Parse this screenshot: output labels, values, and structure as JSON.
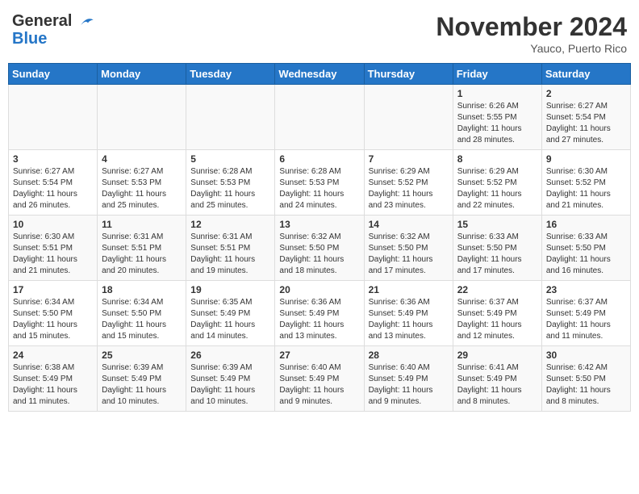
{
  "header": {
    "logo_line1": "General",
    "logo_line2": "Blue",
    "month": "November 2024",
    "location": "Yauco, Puerto Rico"
  },
  "days_of_week": [
    "Sunday",
    "Monday",
    "Tuesday",
    "Wednesday",
    "Thursday",
    "Friday",
    "Saturday"
  ],
  "weeks": [
    [
      {
        "day": "",
        "info": ""
      },
      {
        "day": "",
        "info": ""
      },
      {
        "day": "",
        "info": ""
      },
      {
        "day": "",
        "info": ""
      },
      {
        "day": "",
        "info": ""
      },
      {
        "day": "1",
        "info": "Sunrise: 6:26 AM\nSunset: 5:55 PM\nDaylight: 11 hours and 28 minutes."
      },
      {
        "day": "2",
        "info": "Sunrise: 6:27 AM\nSunset: 5:54 PM\nDaylight: 11 hours and 27 minutes."
      }
    ],
    [
      {
        "day": "3",
        "info": "Sunrise: 6:27 AM\nSunset: 5:54 PM\nDaylight: 11 hours and 26 minutes."
      },
      {
        "day": "4",
        "info": "Sunrise: 6:27 AM\nSunset: 5:53 PM\nDaylight: 11 hours and 25 minutes."
      },
      {
        "day": "5",
        "info": "Sunrise: 6:28 AM\nSunset: 5:53 PM\nDaylight: 11 hours and 25 minutes."
      },
      {
        "day": "6",
        "info": "Sunrise: 6:28 AM\nSunset: 5:53 PM\nDaylight: 11 hours and 24 minutes."
      },
      {
        "day": "7",
        "info": "Sunrise: 6:29 AM\nSunset: 5:52 PM\nDaylight: 11 hours and 23 minutes."
      },
      {
        "day": "8",
        "info": "Sunrise: 6:29 AM\nSunset: 5:52 PM\nDaylight: 11 hours and 22 minutes."
      },
      {
        "day": "9",
        "info": "Sunrise: 6:30 AM\nSunset: 5:52 PM\nDaylight: 11 hours and 21 minutes."
      }
    ],
    [
      {
        "day": "10",
        "info": "Sunrise: 6:30 AM\nSunset: 5:51 PM\nDaylight: 11 hours and 21 minutes."
      },
      {
        "day": "11",
        "info": "Sunrise: 6:31 AM\nSunset: 5:51 PM\nDaylight: 11 hours and 20 minutes."
      },
      {
        "day": "12",
        "info": "Sunrise: 6:31 AM\nSunset: 5:51 PM\nDaylight: 11 hours and 19 minutes."
      },
      {
        "day": "13",
        "info": "Sunrise: 6:32 AM\nSunset: 5:50 PM\nDaylight: 11 hours and 18 minutes."
      },
      {
        "day": "14",
        "info": "Sunrise: 6:32 AM\nSunset: 5:50 PM\nDaylight: 11 hours and 17 minutes."
      },
      {
        "day": "15",
        "info": "Sunrise: 6:33 AM\nSunset: 5:50 PM\nDaylight: 11 hours and 17 minutes."
      },
      {
        "day": "16",
        "info": "Sunrise: 6:33 AM\nSunset: 5:50 PM\nDaylight: 11 hours and 16 minutes."
      }
    ],
    [
      {
        "day": "17",
        "info": "Sunrise: 6:34 AM\nSunset: 5:50 PM\nDaylight: 11 hours and 15 minutes."
      },
      {
        "day": "18",
        "info": "Sunrise: 6:34 AM\nSunset: 5:50 PM\nDaylight: 11 hours and 15 minutes."
      },
      {
        "day": "19",
        "info": "Sunrise: 6:35 AM\nSunset: 5:49 PM\nDaylight: 11 hours and 14 minutes."
      },
      {
        "day": "20",
        "info": "Sunrise: 6:36 AM\nSunset: 5:49 PM\nDaylight: 11 hours and 13 minutes."
      },
      {
        "day": "21",
        "info": "Sunrise: 6:36 AM\nSunset: 5:49 PM\nDaylight: 11 hours and 13 minutes."
      },
      {
        "day": "22",
        "info": "Sunrise: 6:37 AM\nSunset: 5:49 PM\nDaylight: 11 hours and 12 minutes."
      },
      {
        "day": "23",
        "info": "Sunrise: 6:37 AM\nSunset: 5:49 PM\nDaylight: 11 hours and 11 minutes."
      }
    ],
    [
      {
        "day": "24",
        "info": "Sunrise: 6:38 AM\nSunset: 5:49 PM\nDaylight: 11 hours and 11 minutes."
      },
      {
        "day": "25",
        "info": "Sunrise: 6:39 AM\nSunset: 5:49 PM\nDaylight: 11 hours and 10 minutes."
      },
      {
        "day": "26",
        "info": "Sunrise: 6:39 AM\nSunset: 5:49 PM\nDaylight: 11 hours and 10 minutes."
      },
      {
        "day": "27",
        "info": "Sunrise: 6:40 AM\nSunset: 5:49 PM\nDaylight: 11 hours and 9 minutes."
      },
      {
        "day": "28",
        "info": "Sunrise: 6:40 AM\nSunset: 5:49 PM\nDaylight: 11 hours and 9 minutes."
      },
      {
        "day": "29",
        "info": "Sunrise: 6:41 AM\nSunset: 5:49 PM\nDaylight: 11 hours and 8 minutes."
      },
      {
        "day": "30",
        "info": "Sunrise: 6:42 AM\nSunset: 5:50 PM\nDaylight: 11 hours and 8 minutes."
      }
    ]
  ]
}
